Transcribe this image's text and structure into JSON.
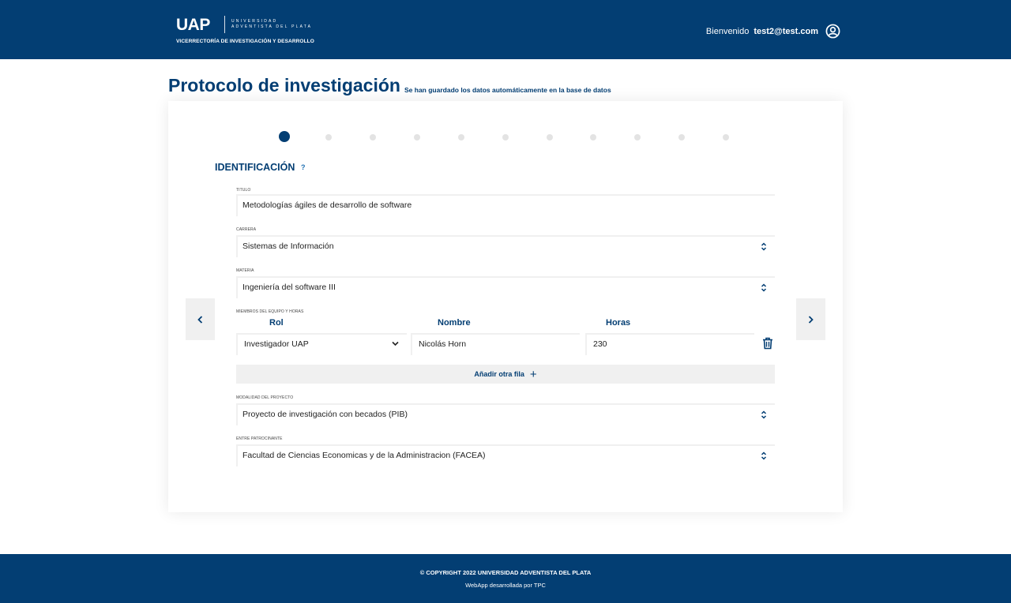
{
  "header": {
    "logo_mark": "UAP",
    "logo_univ_line1": "UNIVERSIDAD",
    "logo_univ_line2": "ADVENTISTA DEL PLATA",
    "logo_subtitle": "VICERRECTORÍA DE INVESTIGACIÓN Y DESARROLLO",
    "welcome_label": "Bienvenido",
    "user_email": "test2@test.com",
    "user_icon": "user-circle-icon"
  },
  "page": {
    "title": "Protocolo de investigación",
    "autosave_message": "Se han guardado los datos automáticamente en la base de datos"
  },
  "stepper": {
    "total_steps": 11,
    "current_step": 1
  },
  "section": {
    "title": "IDENTIFICACIÓN",
    "help_label": "?"
  },
  "form": {
    "titulo": {
      "label": "TITULO",
      "value": "Metodologías ágiles de desarrollo de software"
    },
    "carrera": {
      "label": "CARRERA",
      "value": "Sistemas de  Información"
    },
    "materia": {
      "label": "MATERIA",
      "value": "Ingeniería del software III"
    },
    "miembros": {
      "label": "MIEMBROS DEL EQUIPO Y HORAS",
      "columns": [
        "Rol",
        "Nombre",
        "Horas"
      ],
      "rows": [
        {
          "rol": "Investigador UAP",
          "nombre": "Nicolás Horn",
          "horas": "230"
        }
      ],
      "add_row_label": "Añadir otra fila",
      "add_row_icon": "+"
    },
    "modalidad": {
      "label": "MODALIDAD DEL PROYECTO",
      "value": "Proyecto de investigación con becados (PIB)"
    },
    "ente": {
      "label": "ENTRE PATROCINANTE",
      "value": "Facultad de Ciencias Economicas y de la Administracion (FACEA)"
    }
  },
  "navigation": {
    "prev_icon": "chevron-left-icon",
    "next_icon": "chevron-right-icon"
  },
  "footer": {
    "copyright": "© COPYRIGHT 2022    UNIVERSIDAD ADVENTISTA DEL PLATA",
    "developed_by": "WebApp desarrollada por TPC"
  },
  "colors": {
    "primary": "#033e73",
    "field_border": "#f0f0f0",
    "step_inactive": "#e3e3e3",
    "help_accent": "#1f6fb2"
  }
}
